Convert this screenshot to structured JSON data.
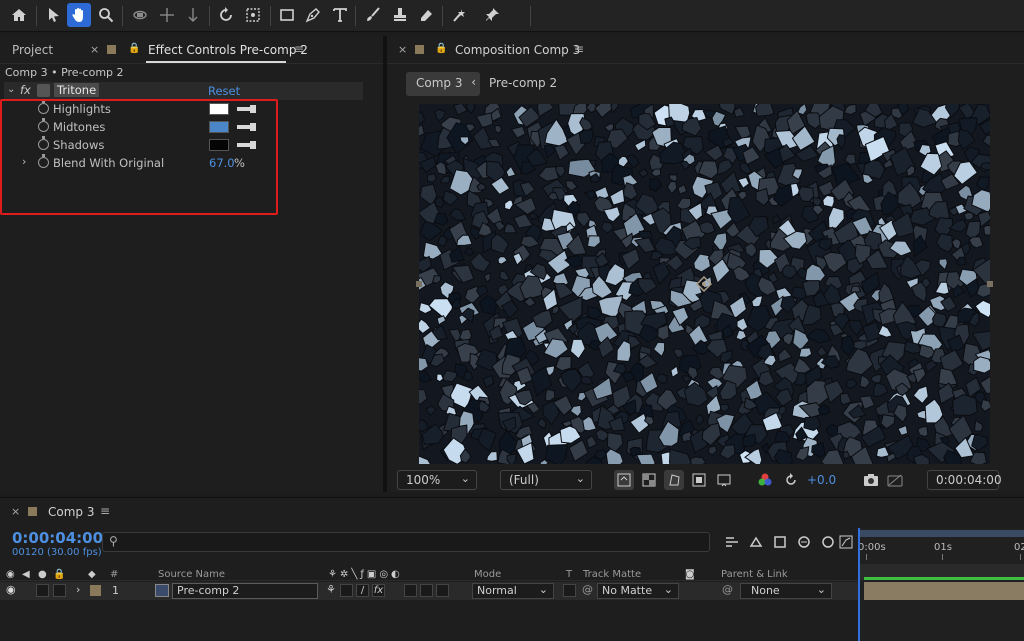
{
  "toolbar": {
    "tools": [
      "home-icon",
      "selection-arrow-icon",
      "hand-icon",
      "zoom-icon",
      "orbit-camera-icon",
      "pan-camera-icon",
      "dolly-camera-icon",
      "rotate-icon",
      "pan-behind-icon",
      "rectangle-icon",
      "pen-icon",
      "type-icon",
      "brush-icon",
      "clone-stamp-icon",
      "eraser-icon",
      "roto-brush-icon",
      "puppet-pin-icon"
    ],
    "active_tool": "hand-icon"
  },
  "left_panel": {
    "tab_project": "Project",
    "tab_effect_controls": "Effect Controls Pre-comp 2",
    "breadcrumb": "Comp 3 • Pre-comp 2",
    "effect_name": "Tritone",
    "reset_label": "Reset",
    "fx_label": "fx",
    "properties": {
      "highlights": {
        "label": "Highlights",
        "color": "#ffffff"
      },
      "midtones": {
        "label": "Midtones",
        "color": "#4a86c8"
      },
      "shadows": {
        "label": "Shadows",
        "color": "#050505"
      },
      "blend": {
        "label": "Blend With Original",
        "value": "67.0",
        "unit": "%"
      }
    }
  },
  "comp_panel": {
    "tab_title": "Composition Comp 3",
    "flow_comp": "Comp 3",
    "flow_precomp": "Pre-comp 2",
    "zoom": "100%",
    "resolution": "(Full)",
    "exposure": "+0.0",
    "current_time": "0:00:04:00"
  },
  "timeline": {
    "tab_title": "Comp 3",
    "time": "0:00:04:00",
    "frames": "00120 (30.00 fps)",
    "columns": {
      "number": "#",
      "source_name": "Source Name",
      "mode": "Mode",
      "t": "T",
      "track_matte": "Track Matte",
      "parent_link": "Parent & Link"
    },
    "layer": {
      "index": "1",
      "name": "Pre-comp 2",
      "mode": "Normal",
      "matte": "No Matte",
      "parent": "None",
      "fx": "fx"
    },
    "ruler": [
      "0:00s",
      "01s",
      "02"
    ]
  },
  "colors": {
    "accent": "#2d6ad6",
    "highlight_box": "#e01b1b",
    "time_blue": "#4d8fe0"
  }
}
